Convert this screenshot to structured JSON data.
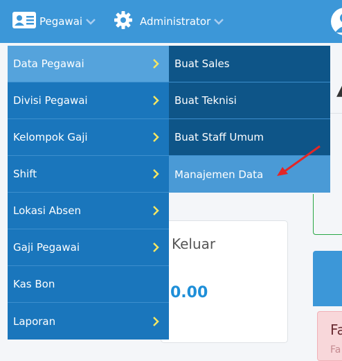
{
  "navbar": {
    "pegawai_label": "Pegawai",
    "admin_label": "Administrator",
    "icons": [
      "id-card-icon",
      "gear-icon",
      "chevron-down-icon",
      "user-avatar-icon"
    ]
  },
  "menu": {
    "left_items": [
      {
        "label": "Data Pegawai",
        "has_submenu": true,
        "active": true
      },
      {
        "label": "Divisi Pegawai",
        "has_submenu": true
      },
      {
        "label": "Kelompok Gaji",
        "has_submenu": true
      },
      {
        "label": "Shift",
        "has_submenu": true
      },
      {
        "label": "Lokasi Absen",
        "has_submenu": true
      },
      {
        "label": "Gaji Pegawai",
        "has_submenu": true
      },
      {
        "label": "Kas Bon",
        "has_submenu": false
      },
      {
        "label": "Laporan",
        "has_submenu": true
      }
    ],
    "right_items": [
      {
        "label": "Buat Sales"
      },
      {
        "label": "Buat Teknisi"
      },
      {
        "label": "Buat Staff Umum"
      },
      {
        "label": "Manajemen Data",
        "highlight": true
      }
    ]
  },
  "background": {
    "card_title": "Keluar",
    "card_value": "0.00",
    "right_fragment": "Fa",
    "right_sub": "Fa"
  },
  "colors": {
    "navbar": "#3c97d8",
    "menu_left": "#1a76bc",
    "menu_left_active": "#55a3dc",
    "menu_right": "#0e5588",
    "menu_right_highlight": "#4a9ad6",
    "chevron": "#f5e663",
    "annotation_arrow": "#e32626"
  }
}
